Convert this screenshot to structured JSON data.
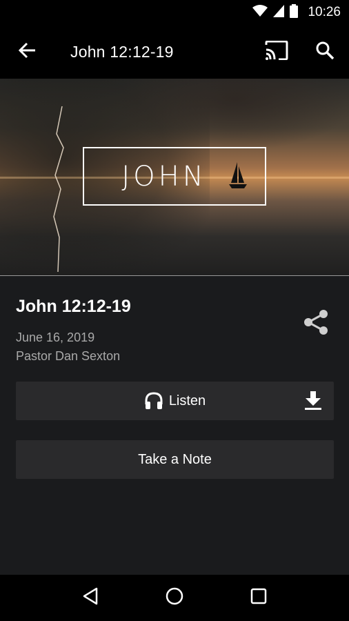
{
  "status_bar": {
    "time": "10:26"
  },
  "app_bar": {
    "title": "John 12:12-19"
  },
  "hero": {
    "word": "JOHN"
  },
  "sermon": {
    "title": "John 12:12-19",
    "date": "June 16, 2019",
    "speaker": "Pastor Dan Sexton"
  },
  "buttons": {
    "listen_label": "Listen",
    "note_label": "Take a Note"
  },
  "icons": {
    "back": "arrow-left-icon",
    "cast": "cast-icon",
    "search": "search-icon",
    "share": "share-icon",
    "headphones": "headphones-icon",
    "download": "download-icon"
  },
  "colors": {
    "background": "#1a1b1d",
    "bars": "#000000",
    "button": "#2a2a2c",
    "secondary_text": "#a9a9a9"
  }
}
